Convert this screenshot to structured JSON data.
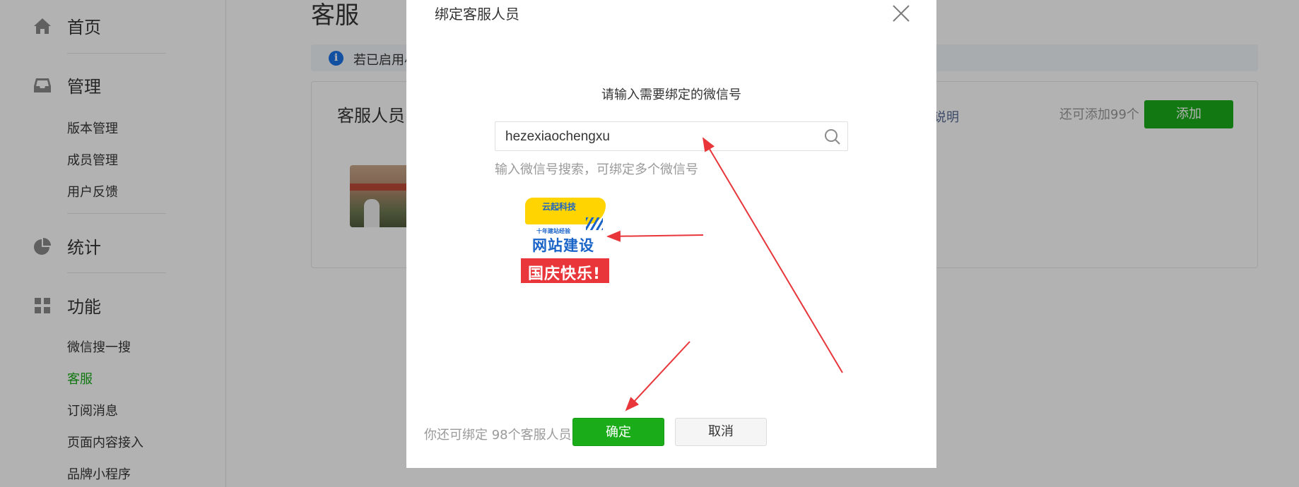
{
  "sidebar": {
    "home": {
      "label": "首页",
      "icon": "home-icon"
    },
    "manage": {
      "label": "管理",
      "icon": "inbox-icon",
      "items": [
        "版本管理",
        "成员管理",
        "用户反馈"
      ]
    },
    "stats": {
      "label": "统计",
      "icon": "pie-chart-icon"
    },
    "features": {
      "label": "功能",
      "icon": "grid-icon",
      "items": [
        "微信搜一搜",
        "客服",
        "订阅消息",
        "页面内容接入",
        "品牌小程序"
      ],
      "active_index": 1
    }
  },
  "main": {
    "page_title": "客服",
    "notice_text": "若已启用小",
    "panel": {
      "title": "客服人员",
      "link": "说明",
      "quota": "还可添加99个",
      "add_button": "添加"
    }
  },
  "modal": {
    "title": "绑定客服人员",
    "prompt": "请输入需要绑定的微信号",
    "search_value": "hezexiaochengxu",
    "search_hint": "输入微信号搜索，可绑定多个微信号",
    "result_image": {
      "logo": "云起科技",
      "tagline": "十年建站经验",
      "headline": "网站建设",
      "banner": "国庆快乐!"
    },
    "remaining_text": "你还可绑定 98个客服人员",
    "confirm_button": "确定",
    "cancel_button": "取消"
  },
  "colors": {
    "accent_green": "#1aad19",
    "link_blue": "#576b95",
    "arrow_red": "#e8363a"
  }
}
